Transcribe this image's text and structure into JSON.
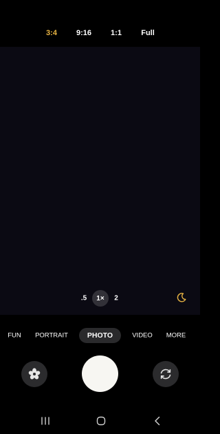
{
  "aspect_ratios": [
    {
      "label": "3:4",
      "active": true
    },
    {
      "label": "9:16",
      "active": false
    },
    {
      "label": "1:1",
      "active": false
    },
    {
      "label": "Full",
      "active": false
    }
  ],
  "zoom": {
    "options": [
      ".5",
      "1×",
      "2"
    ],
    "active": "1×"
  },
  "night_mode_icon": "moon-icon",
  "modes": {
    "items": [
      "FUN",
      "PORTRAIT",
      "PHOTO",
      "VIDEO",
      "MORE"
    ],
    "active": "PHOTO"
  },
  "controls": {
    "left_icon": "flower-effects-icon",
    "center": "shutter-button",
    "right_icon": "switch-camera-icon"
  },
  "nav_bar": [
    "recent-apps-icon",
    "home-icon",
    "back-icon"
  ],
  "colors": {
    "accent": "#e8b443",
    "viewfinder": "#0b0a13",
    "shutter": "#f7f6f2"
  }
}
